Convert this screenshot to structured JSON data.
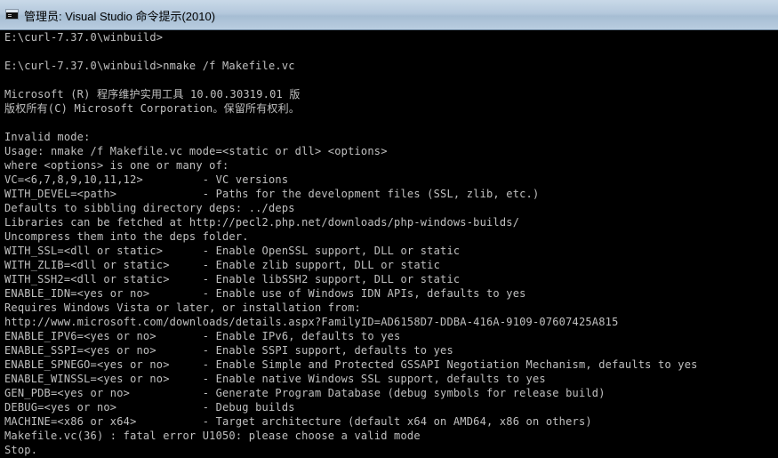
{
  "window": {
    "title": "管理员: Visual Studio 命令提示(2010)",
    "icon": "console-window-icon",
    "background_color": "#000000",
    "text_color": "#c0c0c0"
  },
  "console": {
    "lines": [
      "E:\\curl-7.37.0\\winbuild>",
      "",
      "E:\\curl-7.37.0\\winbuild>nmake /f Makefile.vc",
      "",
      "Microsoft (R) 程序维护实用工具 10.00.30319.01 版",
      "版权所有(C) Microsoft Corporation。保留所有权利。",
      "",
      "Invalid mode:",
      "Usage: nmake /f Makefile.vc mode=<static or dll> <options>",
      "where <options> is one or many of:",
      "VC=<6,7,8,9,10,11,12>         - VC versions",
      "WITH_DEVEL=<path>             - Paths for the development files (SSL, zlib, etc.)",
      "Defaults to sibbling directory deps: ../deps",
      "Libraries can be fetched at http://pecl2.php.net/downloads/php-windows-builds/",
      "Uncompress them into the deps folder.",
      "WITH_SSL=<dll or static>      - Enable OpenSSL support, DLL or static",
      "WITH_ZLIB=<dll or static>     - Enable zlib support, DLL or static",
      "WITH_SSH2=<dll or static>     - Enable libSSH2 support, DLL or static",
      "ENABLE_IDN=<yes or no>        - Enable use of Windows IDN APIs, defaults to yes",
      "Requires Windows Vista or later, or installation from:",
      "http://www.microsoft.com/downloads/details.aspx?FamilyID=AD6158D7-DDBA-416A-9109-07607425A815",
      "ENABLE_IPV6=<yes or no>       - Enable IPv6, defaults to yes",
      "ENABLE_SSPI=<yes or no>       - Enable SSPI support, defaults to yes",
      "ENABLE_SPNEGO=<yes or no>     - Enable Simple and Protected GSSAPI Negotiation Mechanism, defaults to yes",
      "ENABLE_WINSSL=<yes or no>     - Enable native Windows SSL support, defaults to yes",
      "GEN_PDB=<yes or no>           - Generate Program Database (debug symbols for release build)",
      "DEBUG=<yes or no>             - Debug builds",
      "MACHINE=<x86 or x64>          - Target architecture (default x64 on AMD64, x86 on others)",
      "Makefile.vc(36) : fatal error U1050: please choose a valid mode",
      "Stop."
    ]
  }
}
